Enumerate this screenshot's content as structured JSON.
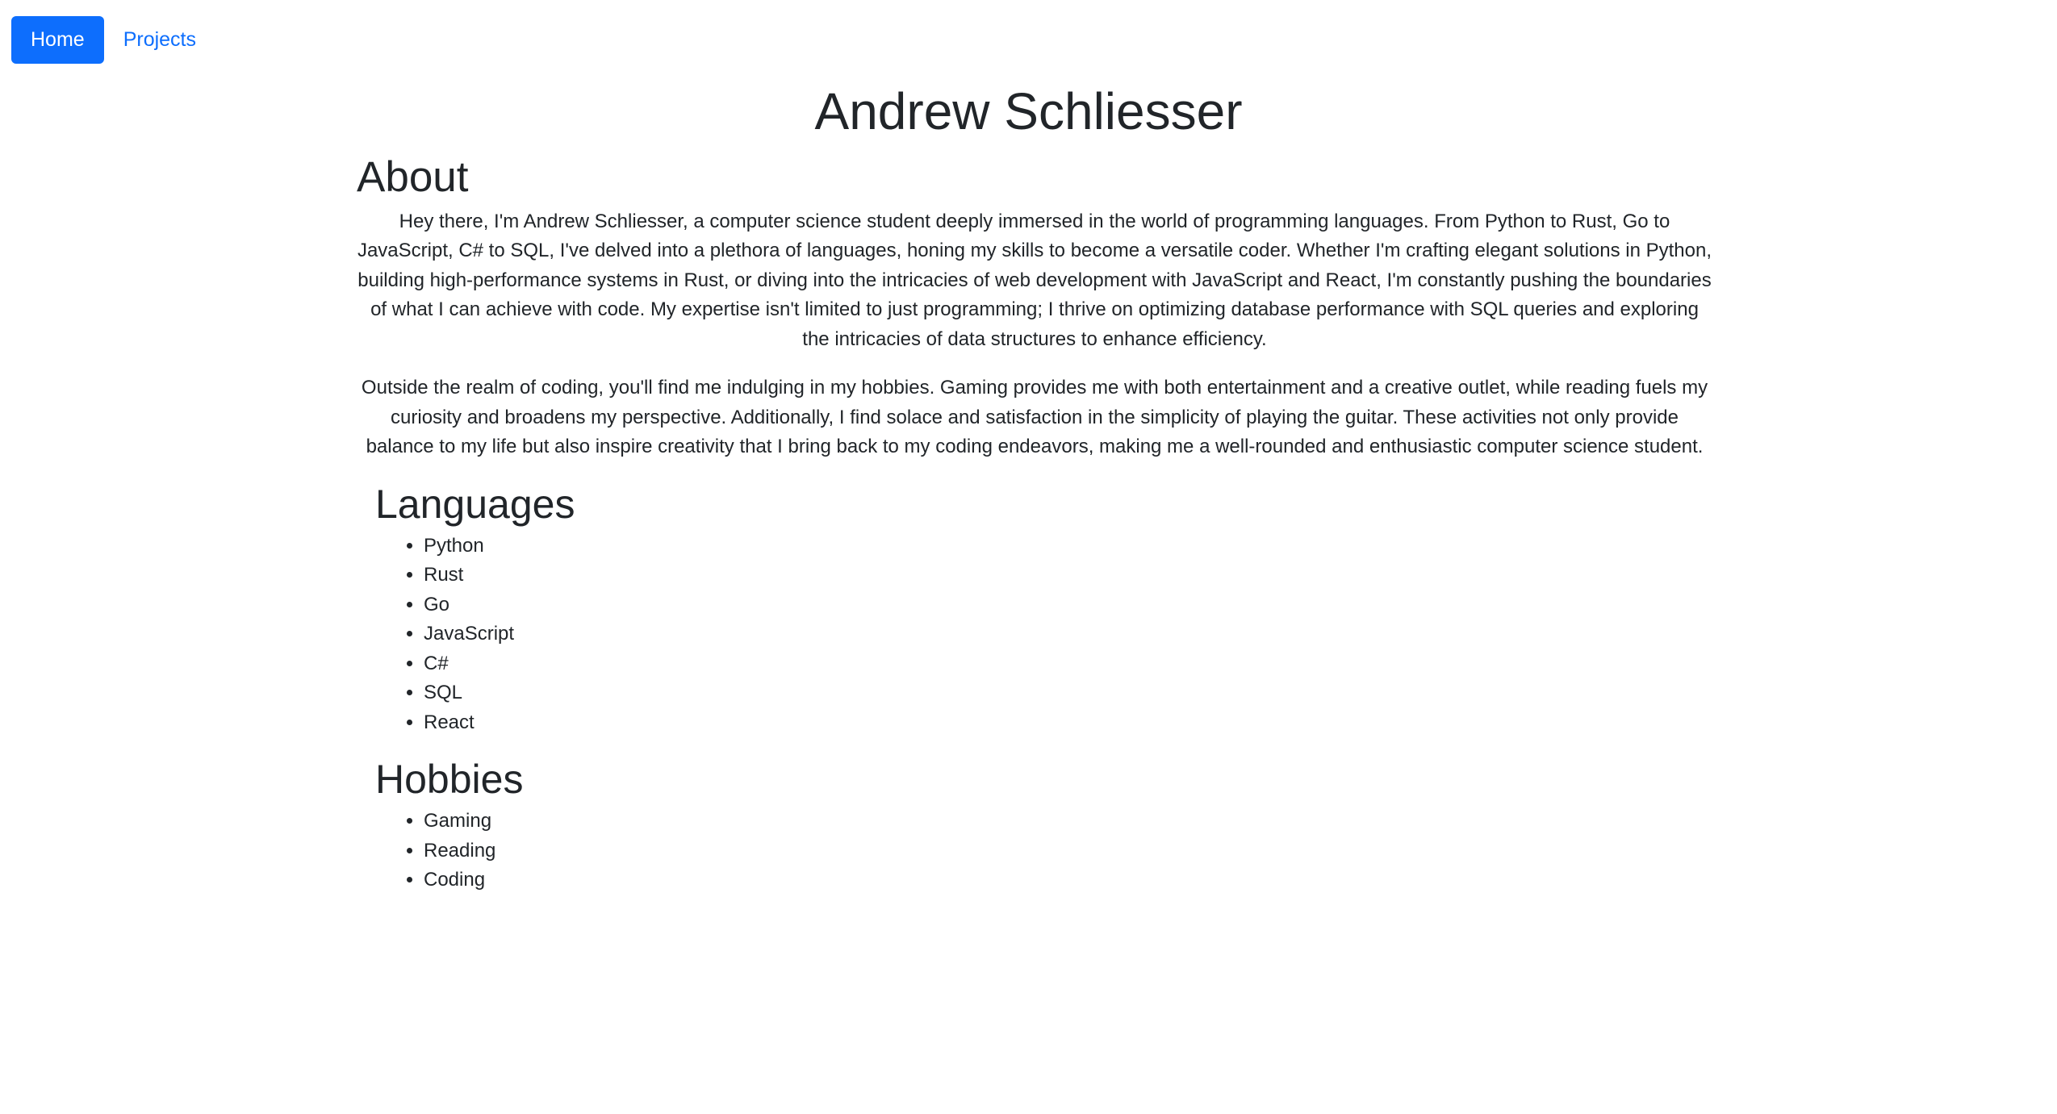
{
  "nav": {
    "home_label": "Home",
    "projects_label": "Projects"
  },
  "colors": {
    "accent": "#0d6efd",
    "text": "#212529",
    "background": "#ffffff"
  },
  "page_title": "Andrew Schliesser",
  "about": {
    "heading": "About",
    "paragraphs": [
      "Hey there, I'm Andrew Schliesser, a computer science student deeply immersed in the world of programming languages. From Python to Rust, Go to JavaScript, C# to SQL, I've delved into a plethora of languages, honing my skills to become a versatile coder. Whether I'm crafting elegant solutions in Python, building high-performance systems in Rust, or diving into the intricacies of web development with JavaScript and React, I'm constantly pushing the boundaries of what I can achieve with code. My expertise isn't limited to just programming; I thrive on optimizing database performance with SQL queries and exploring the intricacies of data structures to enhance efficiency.",
      "Outside the realm of coding, you'll find me indulging in my hobbies. Gaming provides me with both entertainment and a creative outlet, while reading fuels my curiosity and broadens my perspective. Additionally, I find solace and satisfaction in the simplicity of playing the guitar. These activities not only provide balance to my life but also inspire creativity that I bring back to my coding endeavors, making me a well-rounded and enthusiastic computer science student."
    ]
  },
  "languages": {
    "heading": "Languages",
    "items": [
      "Python",
      "Rust",
      "Go",
      "JavaScript",
      "C#",
      "SQL",
      "React"
    ]
  },
  "hobbies": {
    "heading": "Hobbies",
    "items": [
      "Gaming",
      "Reading",
      "Coding"
    ]
  }
}
